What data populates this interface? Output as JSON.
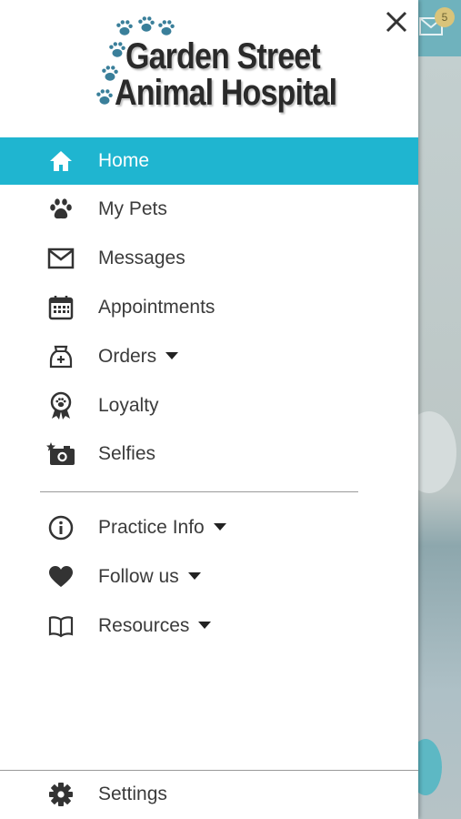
{
  "background": {
    "badge_count": "5"
  },
  "drawer": {
    "logo": {
      "line1": "Garden Street",
      "line2": "Animal Hospital"
    },
    "nav": [
      {
        "label": "Home",
        "icon": "home-icon",
        "active": true
      },
      {
        "label": "My Pets",
        "icon": "paw-icon"
      },
      {
        "label": "Messages",
        "icon": "envelope-icon"
      },
      {
        "label": "Appointments",
        "icon": "calendar-icon"
      },
      {
        "label": "Orders",
        "icon": "pet-food-bag-icon",
        "expandable": true
      },
      {
        "label": "Loyalty",
        "icon": "ribbon-award-icon"
      },
      {
        "label": "Selfies",
        "icon": "camera-icon"
      }
    ],
    "secondary_nav": [
      {
        "label": "Practice Info",
        "icon": "info-icon",
        "expandable": true
      },
      {
        "label": "Follow us",
        "icon": "heart-icon",
        "expandable": true
      },
      {
        "label": "Resources",
        "icon": "book-icon",
        "expandable": true
      }
    ],
    "footer": {
      "settings_label": "Settings",
      "icon": "gear-icon"
    }
  },
  "colors": {
    "active_bg": "#1fb5d0",
    "text": "#3b3b3b",
    "icon": "#333333"
  }
}
